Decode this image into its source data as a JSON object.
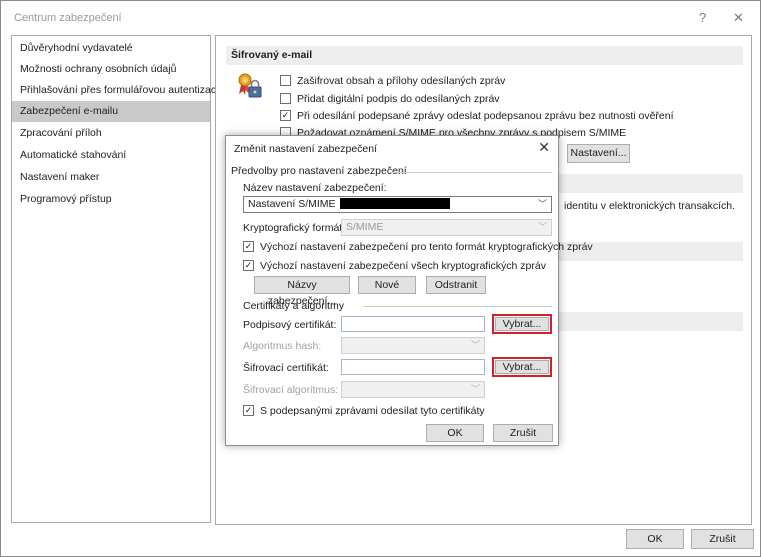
{
  "window": {
    "title": "Centrum zabezpečení",
    "help_glyph": "?",
    "close_glyph": "✕"
  },
  "sidebar": {
    "items": [
      {
        "label": "Důvěryhodní vydavatelé"
      },
      {
        "label": "Možnosti ochrany osobních údajů"
      },
      {
        "label": "Přihlašování přes formulářovou autentizaci"
      },
      {
        "label": "Zabezpečení e-mailu"
      },
      {
        "label": "Zpracování příloh"
      },
      {
        "label": "Automatické stahování"
      },
      {
        "label": "Nastavení maker"
      },
      {
        "label": "Programový přístup"
      }
    ],
    "selected_index": 3
  },
  "main": {
    "section_title": "Šifrovaný e-mail",
    "options": [
      {
        "label": "Zašifrovat obsah a přílohy odesílaných zpráv",
        "checked": false
      },
      {
        "label": "Přidat digitální podpis do odesílaných zpráv",
        "checked": false
      },
      {
        "label": "Při odesílání podepsané zprávy odeslat podepsanou zprávu bez nutnosti ověření",
        "checked": true
      },
      {
        "label": "Požadovat oznámení S/MIME pro všechny zprávy s podpisem S/MIME",
        "checked": false
      }
    ],
    "settings_button": "Nastavení...",
    "partial_text": "identitu v elektronických transakcích."
  },
  "dialog": {
    "title": "Změnit nastavení zabezpečení",
    "close_glyph": "✕",
    "presets_group": "Předvolby pro nastavení zabezpečení",
    "settings_name_label": "Název nastavení zabezpečení:",
    "settings_name_value": "Nastavení S/MIME",
    "crypto_format_label": "Kryptografický formát:",
    "crypto_format_value": "S/MIME",
    "default_format_checkbox": {
      "label": "Výchozí nastavení zabezpečení pro tento formát kryptografických zpráv",
      "checked": true
    },
    "default_all_checkbox": {
      "label": "Výchozí nastavení zabezpečení všech kryptografických zpráv",
      "checked": true
    },
    "btn_labels": "Názvy zabezpečení...",
    "btn_new": "Nové",
    "btn_delete": "Odstranit",
    "certs_group": "Certifikáty a algoritmy",
    "signing_cert_label": "Podpisový certifikát:",
    "hash_algo_label": "Algoritmus hash:",
    "encryption_cert_label": "Šifrovací certifikát:",
    "encryption_algo_label": "Šifrovací algoritmus:",
    "choose_button": "Vybrat...",
    "send_certs_checkbox": {
      "label": "S podepsanými zprávami odesílat tyto certifikáty",
      "checked": true
    },
    "ok": "OK",
    "cancel": "Zrušit",
    "highlight_color": "#d21f2a"
  },
  "footer": {
    "ok": "OK",
    "cancel": "Zrušit"
  }
}
